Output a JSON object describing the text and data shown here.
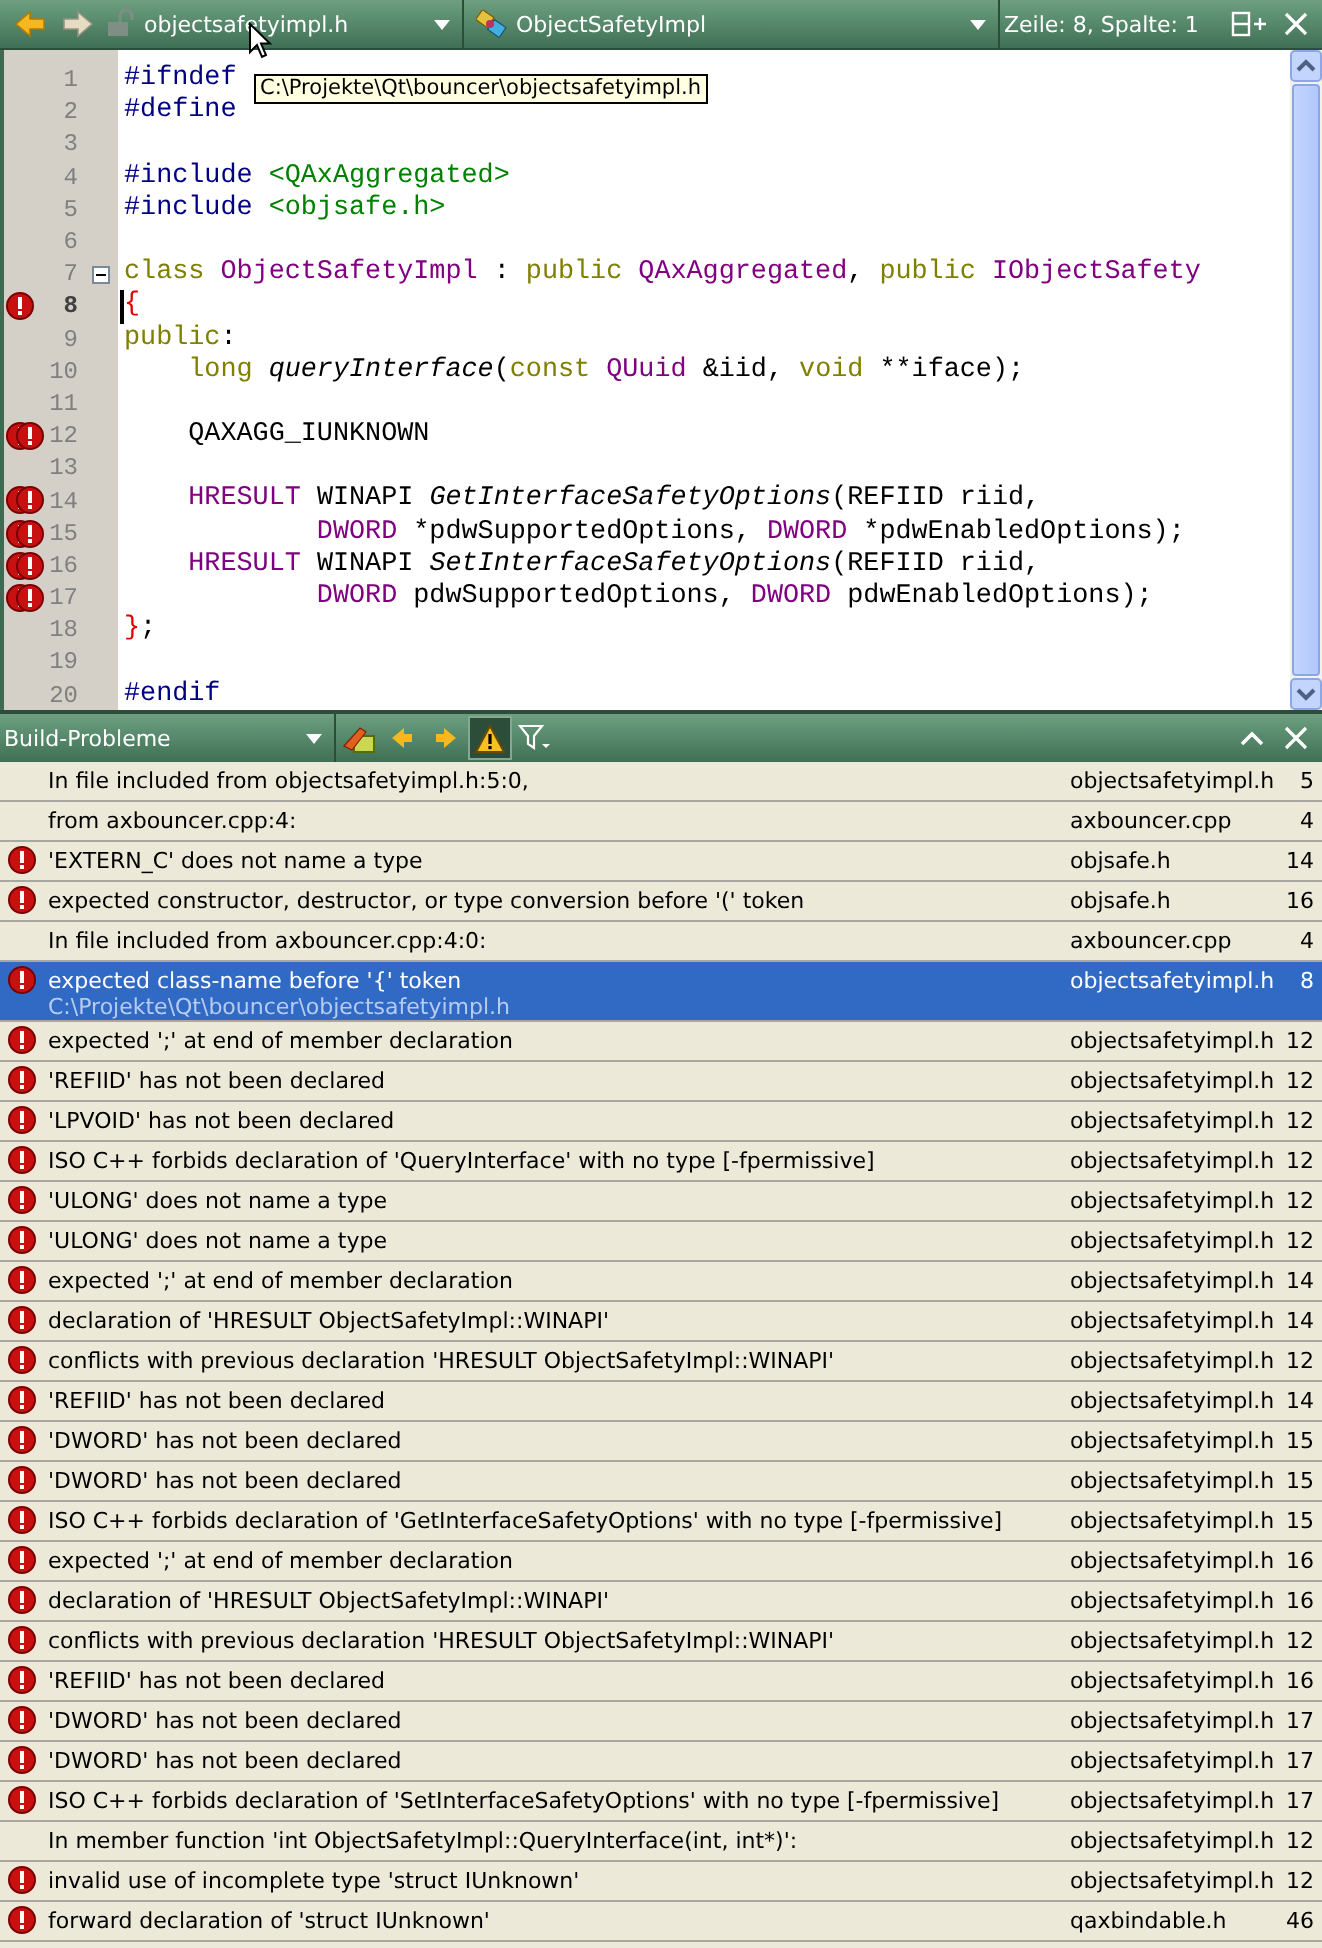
{
  "toolbar": {
    "file": "objectsafetyimpl.h",
    "symbol": "ObjectSafetyImpl",
    "position": "Zeile: 8, Spalte: 1"
  },
  "tooltip": "C:\\Projekte\\Qt\\bouncer\\objectsafetyimpl.h",
  "editor": {
    "lines": [
      {
        "number": "1",
        "error": false,
        "fold": false,
        "current": false,
        "segments": [
          {
            "kind": "preproc",
            "text": "#ifndef"
          }
        ]
      },
      {
        "number": "2",
        "error": false,
        "fold": false,
        "current": false,
        "segments": [
          {
            "kind": "preproc",
            "text": "#define"
          }
        ]
      },
      {
        "number": "3",
        "error": false,
        "fold": false,
        "current": false
      },
      {
        "number": "4",
        "error": false,
        "fold": false,
        "current": false,
        "segments": [
          {
            "kind": "preproc",
            "text": "#include "
          },
          {
            "kind": "string",
            "text": "<QAxAggregated>"
          }
        ]
      },
      {
        "number": "5",
        "error": false,
        "fold": false,
        "current": false,
        "segments": [
          {
            "kind": "preproc",
            "text": "#include "
          },
          {
            "kind": "string",
            "text": "<objsafe.h>"
          }
        ]
      },
      {
        "number": "6",
        "error": false,
        "fold": false,
        "current": false
      },
      {
        "number": "7",
        "error": false,
        "fold": true,
        "current": false,
        "segments": [
          {
            "kind": "keyword",
            "text": "class "
          },
          {
            "kind": "type",
            "text": "ObjectSafetyImpl"
          },
          {
            "kind": "plain",
            "text": " : "
          },
          {
            "kind": "keyword",
            "text": "public "
          },
          {
            "kind": "type",
            "text": "QAxAggregated"
          },
          {
            "kind": "plain",
            "text": ", "
          },
          {
            "kind": "keyword",
            "text": "public "
          },
          {
            "kind": "type",
            "text": "IObjectSafety"
          }
        ]
      },
      {
        "number": "8",
        "error": true,
        "multiple_errors": false,
        "fold": false,
        "current": true,
        "segments": [
          {
            "kind": "brace",
            "text": "{"
          }
        ]
      },
      {
        "number": "9",
        "error": false,
        "fold": false,
        "current": false,
        "segments": [
          {
            "kind": "keyword",
            "text": "public"
          },
          {
            "kind": "plain",
            "text": ":"
          }
        ]
      },
      {
        "number": "10",
        "error": false,
        "fold": false,
        "current": false,
        "segments": [
          {
            "kind": "keyword",
            "text": "    long "
          },
          {
            "kind": "function",
            "text": "queryInterface"
          },
          {
            "kind": "plain",
            "text": "("
          },
          {
            "kind": "keyword",
            "text": "const "
          },
          {
            "kind": "type",
            "text": "QUuid"
          },
          {
            "kind": "plain",
            "text": " &iid, "
          },
          {
            "kind": "keyword",
            "text": "void"
          },
          {
            "kind": "plain",
            "text": " **iface);"
          }
        ]
      },
      {
        "number": "11",
        "error": false,
        "fold": false,
        "current": false
      },
      {
        "number": "12",
        "error": true,
        "multiple_errors": true,
        "fold": false,
        "current": false,
        "segments": [
          {
            "kind": "plain",
            "text": "    QAXAGG_IUNKNOWN"
          }
        ]
      },
      {
        "number": "13",
        "error": false,
        "fold": false,
        "current": false
      },
      {
        "number": "14",
        "error": true,
        "multiple_errors": true,
        "fold": false,
        "current": false,
        "segments": [
          {
            "kind": "type",
            "text": "    HRESULT"
          },
          {
            "kind": "plain",
            "text": " WINAPI "
          },
          {
            "kind": "function",
            "text": "GetInterfaceSafetyOptions"
          },
          {
            "kind": "plain",
            "text": "(REFIID riid,"
          }
        ]
      },
      {
        "number": "15",
        "error": true,
        "multiple_errors": true,
        "fold": false,
        "current": false,
        "segments": [
          {
            "kind": "type",
            "text": "            DWORD"
          },
          {
            "kind": "plain",
            "text": " *pdwSupportedOptions, "
          },
          {
            "kind": "type",
            "text": "DWORD"
          },
          {
            "kind": "plain",
            "text": " *pdwEnabledOptions);"
          }
        ]
      },
      {
        "number": "16",
        "error": true,
        "multiple_errors": true,
        "fold": false,
        "current": false,
        "segments": [
          {
            "kind": "type",
            "text": "    HRESULT"
          },
          {
            "kind": "plain",
            "text": " WINAPI "
          },
          {
            "kind": "function",
            "text": "SetInterfaceSafetyOptions"
          },
          {
            "kind": "plain",
            "text": "(REFIID riid,"
          }
        ]
      },
      {
        "number": "17",
        "error": true,
        "multiple_errors": true,
        "fold": false,
        "current": false,
        "segments": [
          {
            "kind": "type",
            "text": "            DWORD"
          },
          {
            "kind": "plain",
            "text": " pdwSupportedOptions, "
          },
          {
            "kind": "type",
            "text": "DWORD"
          },
          {
            "kind": "plain",
            "text": " pdwEnabledOptions);"
          }
        ]
      },
      {
        "number": "18",
        "error": false,
        "fold": false,
        "current": false,
        "segments": [
          {
            "kind": "brace",
            "text": "}"
          },
          {
            "kind": "plain",
            "text": ";"
          }
        ]
      },
      {
        "number": "19",
        "error": false,
        "fold": false,
        "current": false
      },
      {
        "number": "20",
        "error": false,
        "fold": false,
        "current": false,
        "segments": [
          {
            "kind": "preproc",
            "text": "#endif"
          }
        ]
      }
    ]
  },
  "problems": {
    "title": "Build-Probleme",
    "rows": [
      {
        "kind": "info",
        "text": "In file included from objectsafetyimpl.h:5:0,",
        "file": "objectsafetyimpl.h",
        "line": "5",
        "selected": false
      },
      {
        "kind": "info",
        "text": "from axbouncer.cpp:4:",
        "file": "axbouncer.cpp",
        "line": "4",
        "selected": false
      },
      {
        "kind": "error",
        "text": "'EXTERN_C' does not name a type",
        "file": "objsafe.h",
        "line": "14",
        "selected": false
      },
      {
        "kind": "error",
        "text": "expected constructor, destructor, or type conversion before '(' token",
        "file": "objsafe.h",
        "line": "16",
        "selected": false
      },
      {
        "kind": "info",
        "text": "In file included from axbouncer.cpp:4:0:",
        "file": "axbouncer.cpp",
        "line": "4",
        "selected": false
      },
      {
        "kind": "error",
        "text": "expected class-name before '{' token",
        "path": "C:\\Projekte\\Qt\\bouncer\\objectsafetyimpl.h",
        "file": "objectsafetyimpl.h",
        "line": "8",
        "selected": true
      },
      {
        "kind": "error",
        "text": "expected ';' at end of member declaration",
        "file": "objectsafetyimpl.h",
        "line": "12",
        "selected": false
      },
      {
        "kind": "error",
        "text": "'REFIID' has not been declared",
        "file": "objectsafetyimpl.h",
        "line": "12",
        "selected": false
      },
      {
        "kind": "error",
        "text": "'LPVOID' has not been declared",
        "file": "objectsafetyimpl.h",
        "line": "12",
        "selected": false
      },
      {
        "kind": "error",
        "text": "ISO C++ forbids declaration of 'QueryInterface' with no type [-fpermissive]",
        "file": "objectsafetyimpl.h",
        "line": "12",
        "selected": false
      },
      {
        "kind": "error",
        "text": "'ULONG' does not name a type",
        "file": "objectsafetyimpl.h",
        "line": "12",
        "selected": false
      },
      {
        "kind": "error",
        "text": "'ULONG' does not name a type",
        "file": "objectsafetyimpl.h",
        "line": "12",
        "selected": false
      },
      {
        "kind": "error",
        "text": "expected ';' at end of member declaration",
        "file": "objectsafetyimpl.h",
        "line": "14",
        "selected": false
      },
      {
        "kind": "error",
        "text": "declaration of 'HRESULT ObjectSafetyImpl::WINAPI'",
        "file": "objectsafetyimpl.h",
        "line": "14",
        "selected": false
      },
      {
        "kind": "error",
        "text": "conflicts with previous declaration 'HRESULT ObjectSafetyImpl::WINAPI'",
        "file": "objectsafetyimpl.h",
        "line": "12",
        "selected": false
      },
      {
        "kind": "error",
        "text": "'REFIID' has not been declared",
        "file": "objectsafetyimpl.h",
        "line": "14",
        "selected": false
      },
      {
        "kind": "error",
        "text": "'DWORD' has not been declared",
        "file": "objectsafetyimpl.h",
        "line": "15",
        "selected": false
      },
      {
        "kind": "error",
        "text": "'DWORD' has not been declared",
        "file": "objectsafetyimpl.h",
        "line": "15",
        "selected": false
      },
      {
        "kind": "error",
        "text": "ISO C++ forbids declaration of 'GetInterfaceSafetyOptions' with no type [-fpermissive]",
        "file": "objectsafetyimpl.h",
        "line": "15",
        "selected": false
      },
      {
        "kind": "error",
        "text": "expected ';' at end of member declaration",
        "file": "objectsafetyimpl.h",
        "line": "16",
        "selected": false
      },
      {
        "kind": "error",
        "text": "declaration of 'HRESULT ObjectSafetyImpl::WINAPI'",
        "file": "objectsafetyimpl.h",
        "line": "16",
        "selected": false
      },
      {
        "kind": "error",
        "text": "conflicts with previous declaration 'HRESULT ObjectSafetyImpl::WINAPI'",
        "file": "objectsafetyimpl.h",
        "line": "12",
        "selected": false
      },
      {
        "kind": "error",
        "text": "'REFIID' has not been declared",
        "file": "objectsafetyimpl.h",
        "line": "16",
        "selected": false
      },
      {
        "kind": "error",
        "text": "'DWORD' has not been declared",
        "file": "objectsafetyimpl.h",
        "line": "17",
        "selected": false
      },
      {
        "kind": "error",
        "text": "'DWORD' has not been declared",
        "file": "objectsafetyimpl.h",
        "line": "17",
        "selected": false
      },
      {
        "kind": "error",
        "text": "ISO C++ forbids declaration of 'SetInterfaceSafetyOptions' with no type [-fpermissive]",
        "file": "objectsafetyimpl.h",
        "line": "17",
        "selected": false
      },
      {
        "kind": "info",
        "text": "In member function 'int ObjectSafetyImpl::QueryInterface(int, int*)':",
        "file": "objectsafetyimpl.h",
        "line": "12",
        "selected": false
      },
      {
        "kind": "error",
        "text": "invalid use of incomplete type 'struct IUnknown'",
        "file": "objectsafetyimpl.h",
        "line": "12",
        "selected": false
      },
      {
        "kind": "error",
        "text": "forward declaration of 'struct IUnknown'",
        "file": "qaxbindable.h",
        "line": "46",
        "selected": false
      }
    ]
  }
}
